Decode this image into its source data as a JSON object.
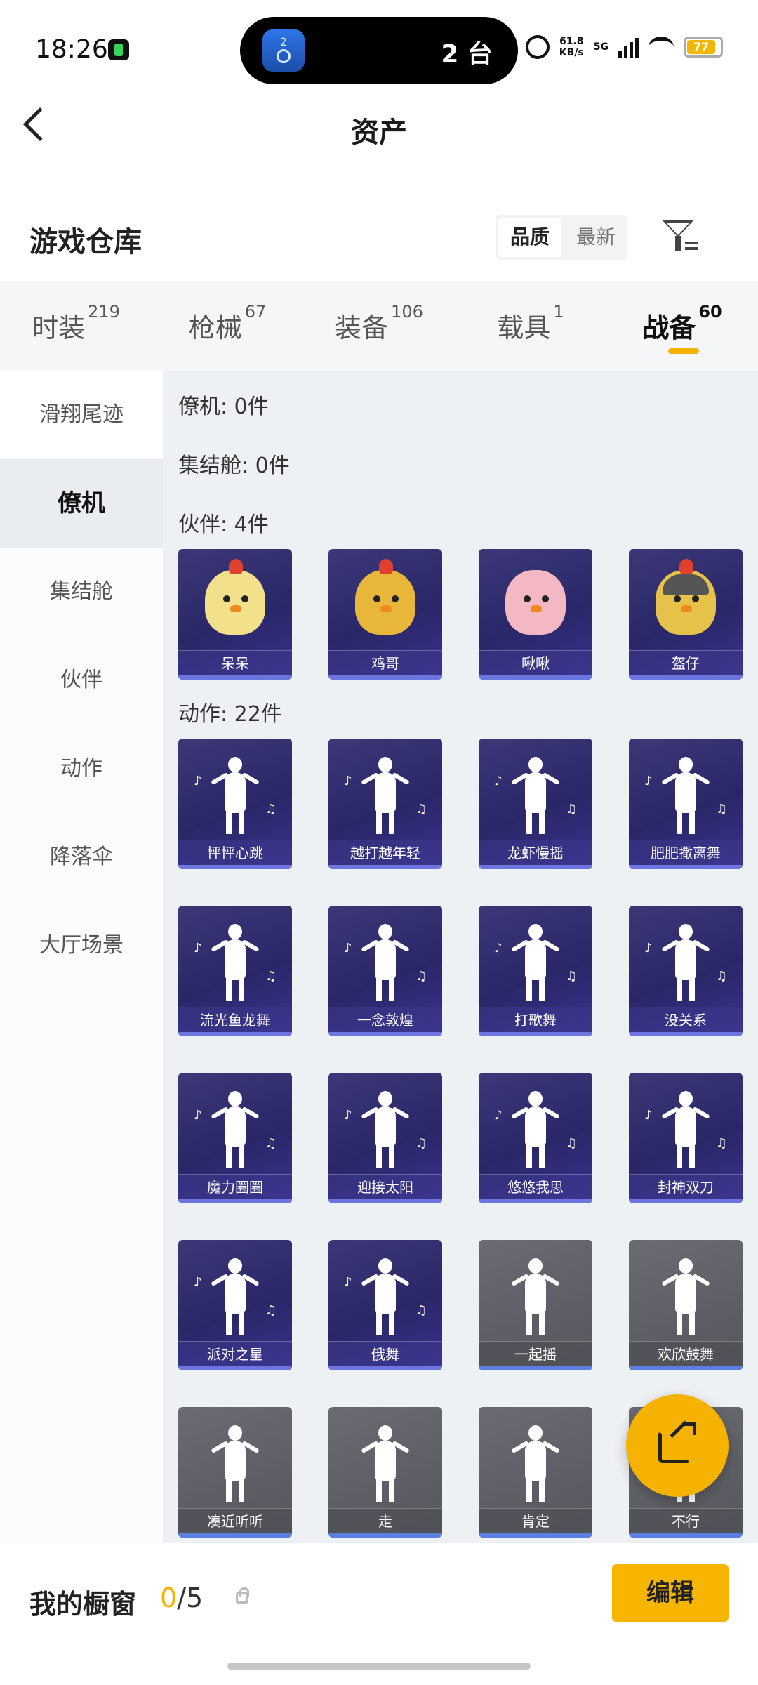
{
  "status": {
    "time": "18:26",
    "island_badge": "2",
    "island_text": "2 台",
    "speed_top": "61.8",
    "speed_bottom": "KB/s",
    "network": "5G",
    "battery": "77"
  },
  "header": {
    "title": "资产"
  },
  "warehouse": {
    "title": "游戏仓库",
    "sort_options": [
      "品质",
      "最新"
    ],
    "sort_selected": "品质"
  },
  "tabs": [
    {
      "label": "时装",
      "count": "219"
    },
    {
      "label": "枪械",
      "count": "67"
    },
    {
      "label": "装备",
      "count": "106"
    },
    {
      "label": "载具",
      "count": "1"
    },
    {
      "label": "战备",
      "count": "60",
      "selected": true
    }
  ],
  "sidebar": [
    "滑翔尾迹",
    "僚机",
    "集结舱",
    "伙伴",
    "动作",
    "降落伞",
    "大厅场景"
  ],
  "sections": {
    "wingman": "僚机: 0件",
    "capsule": "集结舱: 0件",
    "partner": "伙伴: 4件",
    "emote": "动作: 22件"
  },
  "partners": [
    "呆呆",
    "鸡哥",
    "啾啾",
    "盔仔"
  ],
  "emotes": [
    "怦怦心跳",
    "越打越年轻",
    "龙虾慢摇",
    "肥肥撒离舞",
    "流光鱼龙舞",
    "一念敦煌",
    "打歌舞",
    "没关系",
    "魔力圈圈",
    "迎接太阳",
    "悠悠我思",
    "封神双刀",
    "派对之星",
    "俄舞",
    "一起摇",
    "欢欣鼓舞",
    "凑近听听",
    "走",
    "肯定",
    "不行"
  ],
  "bottom": {
    "title": "我的橱窗",
    "count_current": "0",
    "count_total": "/5",
    "edit_label": "编辑"
  }
}
